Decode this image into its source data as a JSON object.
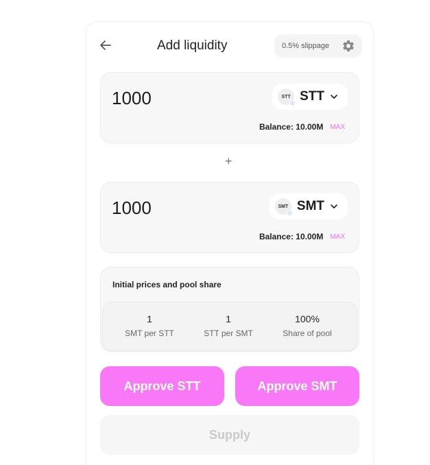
{
  "header": {
    "title": "Add liquidity",
    "slippage": "0.5% slippage"
  },
  "token_a": {
    "amount": "1000",
    "symbol": "STT",
    "logo_text": "STT",
    "balance": "Balance: 10.00M",
    "max_label": "MAX"
  },
  "token_b": {
    "amount": "1000",
    "symbol": "SMT",
    "logo_text": "SMT",
    "balance": "Balance: 10.00M",
    "max_label": "MAX"
  },
  "plus": "+",
  "prices": {
    "title": "Initial prices and pool share",
    "stats": [
      {
        "value": "1",
        "label": "SMT per STT"
      },
      {
        "value": "1",
        "label": "STT per SMT"
      },
      {
        "value": "100%",
        "label": "Share of pool"
      }
    ]
  },
  "buttons": {
    "approve_a": "Approve STT",
    "approve_b": "Approve SMT",
    "supply": "Supply"
  },
  "colors": {
    "accent": "#f978f7",
    "max": "#f66ef4",
    "disabled_bg": "#f6f6f6",
    "disabled_text": "#c9c9c9"
  }
}
